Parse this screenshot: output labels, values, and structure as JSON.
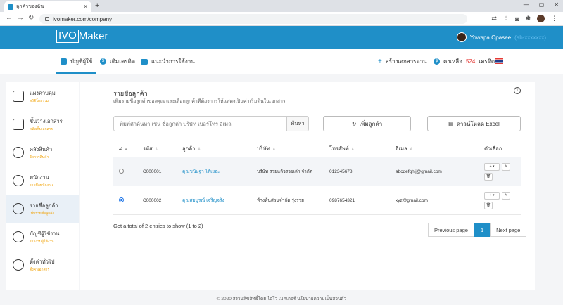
{
  "browser": {
    "tab_title": "ลูกค้าของฉัน",
    "url": "ivomaker.com/company"
  },
  "header": {
    "logo_box": "IVO",
    "logo_rest": "Maker",
    "user_name": "Yowapa Opasee",
    "user_id": "(ab-xxxxxxx)"
  },
  "subnav": {
    "account": "บัญชีผู้ใช้",
    "topup": "เติมเครดิต",
    "guide": "แนะนำการใช้งาน",
    "quick_doc": "สร้างเอกสารด่วน",
    "credit_prefix": "คงเหลือ",
    "credit_value": "524",
    "credit_suffix": "เครดิต"
  },
  "sidebar": {
    "items": [
      {
        "label": "แผงควบคุม",
        "sub": "สถิติโดยรวม"
      },
      {
        "label": "ชั้นวางเอกสาร",
        "sub": "คลังเก็บเอกสาร"
      },
      {
        "label": "คลังสินค้า",
        "sub": "จัดการสินค้า"
      },
      {
        "label": "พนักงาน",
        "sub": "รายชื่อพนักงาน"
      },
      {
        "label": "รายชื่อลูกค้า",
        "sub": "เพิ่มรายชื่อลูกค้า"
      },
      {
        "label": "บัญชีผู้ใช้งาน",
        "sub": "รายงานผู้ใช้งาน"
      },
      {
        "label": "ตั้งค่าทั่วไป",
        "sub": "ตั้งค่าเอกสาร"
      }
    ]
  },
  "main": {
    "title": "รายชื่อลูกค้า",
    "desc": "เพิ่มรายชื่อลูกค้าของคุณ และเลือกลูกค้าที่ต้องการให้แสดงเป็นค่าเริ่มต้นในเอกสาร",
    "search_placeholder": "พิมพ์คำค้นหา เช่น ชื่อลูกค้า บริษัท เบอร์โทร อีเมล",
    "search_button": "ค้นหา",
    "add_button": "เพิ่มลูกค้า",
    "download_button": "ดาวน์โหลด Excel",
    "columns": [
      "#",
      "รหัส",
      "ลูกค้า",
      "บริษัท",
      "โทรศัพท์",
      "อีเมล",
      "ตัวเลือก"
    ],
    "rows": [
      {
        "code": "C000001",
        "name": "คุณขนิษฐา ได้เยอะ",
        "company": "บริษัท รวยแล้วรวยเล่า จำกัด",
        "phone": "012345678",
        "email": "abcdefghij@gmail.com",
        "selected": false
      },
      {
        "code": "C000002",
        "name": "คุณสมบูรณ์ เจริญจริง",
        "company": "ห้างหุ้นส่วนจำกัด รุ่งรวย",
        "phone": "0987654321",
        "email": "xyz@gmail.com",
        "selected": true
      }
    ],
    "total_text": "Got a total of 2 entries to show (1 to 2)",
    "pager": {
      "prev": "Previous page",
      "current": "1",
      "next": "Next page"
    }
  },
  "footer": "© 2020 สงวนลิขสิทธิ์โดย ไอโว เมคเกอร์ นโยบายความเป็นส่วนตัว",
  "colors": {
    "brand": "#1f8fc8",
    "credit": "#e53935",
    "sidebar_sub": "#f0a000"
  }
}
